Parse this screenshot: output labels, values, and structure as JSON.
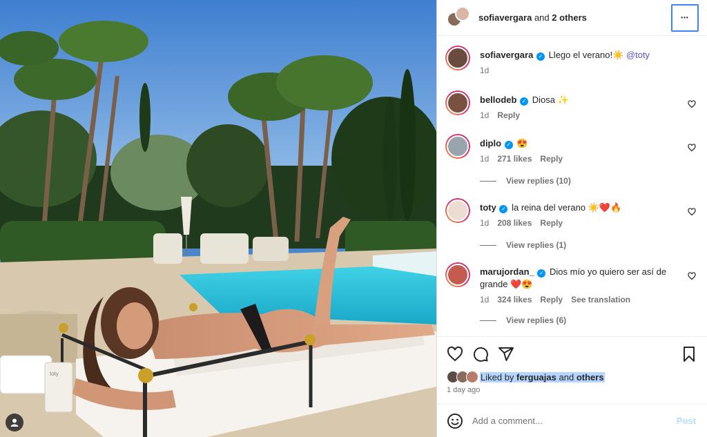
{
  "header": {
    "username": "sofiavergara",
    "joiner": "and",
    "others": "2 others",
    "more_label": "•••"
  },
  "caption": {
    "username": "sofiavergara",
    "text": "Llego el verano!☀️",
    "mention": "@toty",
    "time": "1d"
  },
  "comments": [
    {
      "username": "bellodeb",
      "verified": true,
      "text": "Diosa ✨",
      "time": "1d",
      "likes": "",
      "reply": "Reply",
      "translate": "",
      "view_replies": ""
    },
    {
      "username": "diplo",
      "verified": true,
      "text": "😍",
      "time": "1d",
      "likes": "271 likes",
      "reply": "Reply",
      "translate": "",
      "view_replies": "View replies (10)"
    },
    {
      "username": "toty",
      "verified": true,
      "text": "la reina del verano ☀️❤️🔥",
      "time": "1d",
      "likes": "208 likes",
      "reply": "Reply",
      "translate": "",
      "view_replies": "View replies (1)"
    },
    {
      "username": "marujordan_",
      "verified": true,
      "text": "Dios mío yo quiero ser así de grande ❤️😍",
      "time": "1d",
      "likes": "324 likes",
      "reply": "Reply",
      "translate": "See translation",
      "view_replies": "View replies (6)"
    }
  ],
  "likes": {
    "prefix": "Liked by",
    "user": "ferguajas",
    "joiner": "and",
    "suffix": "others"
  },
  "age": "1 day ago",
  "add_comment": {
    "placeholder": "Add a comment...",
    "post_label": "Post"
  },
  "photo": {
    "bottle_label": "toty",
    "icons": [
      "user-tag-icon"
    ]
  },
  "colors": {
    "accent": "#0095f6",
    "mention": "#5b51d8",
    "selection": "#b5d5ff",
    "focus_ring": "#3b82f6"
  }
}
